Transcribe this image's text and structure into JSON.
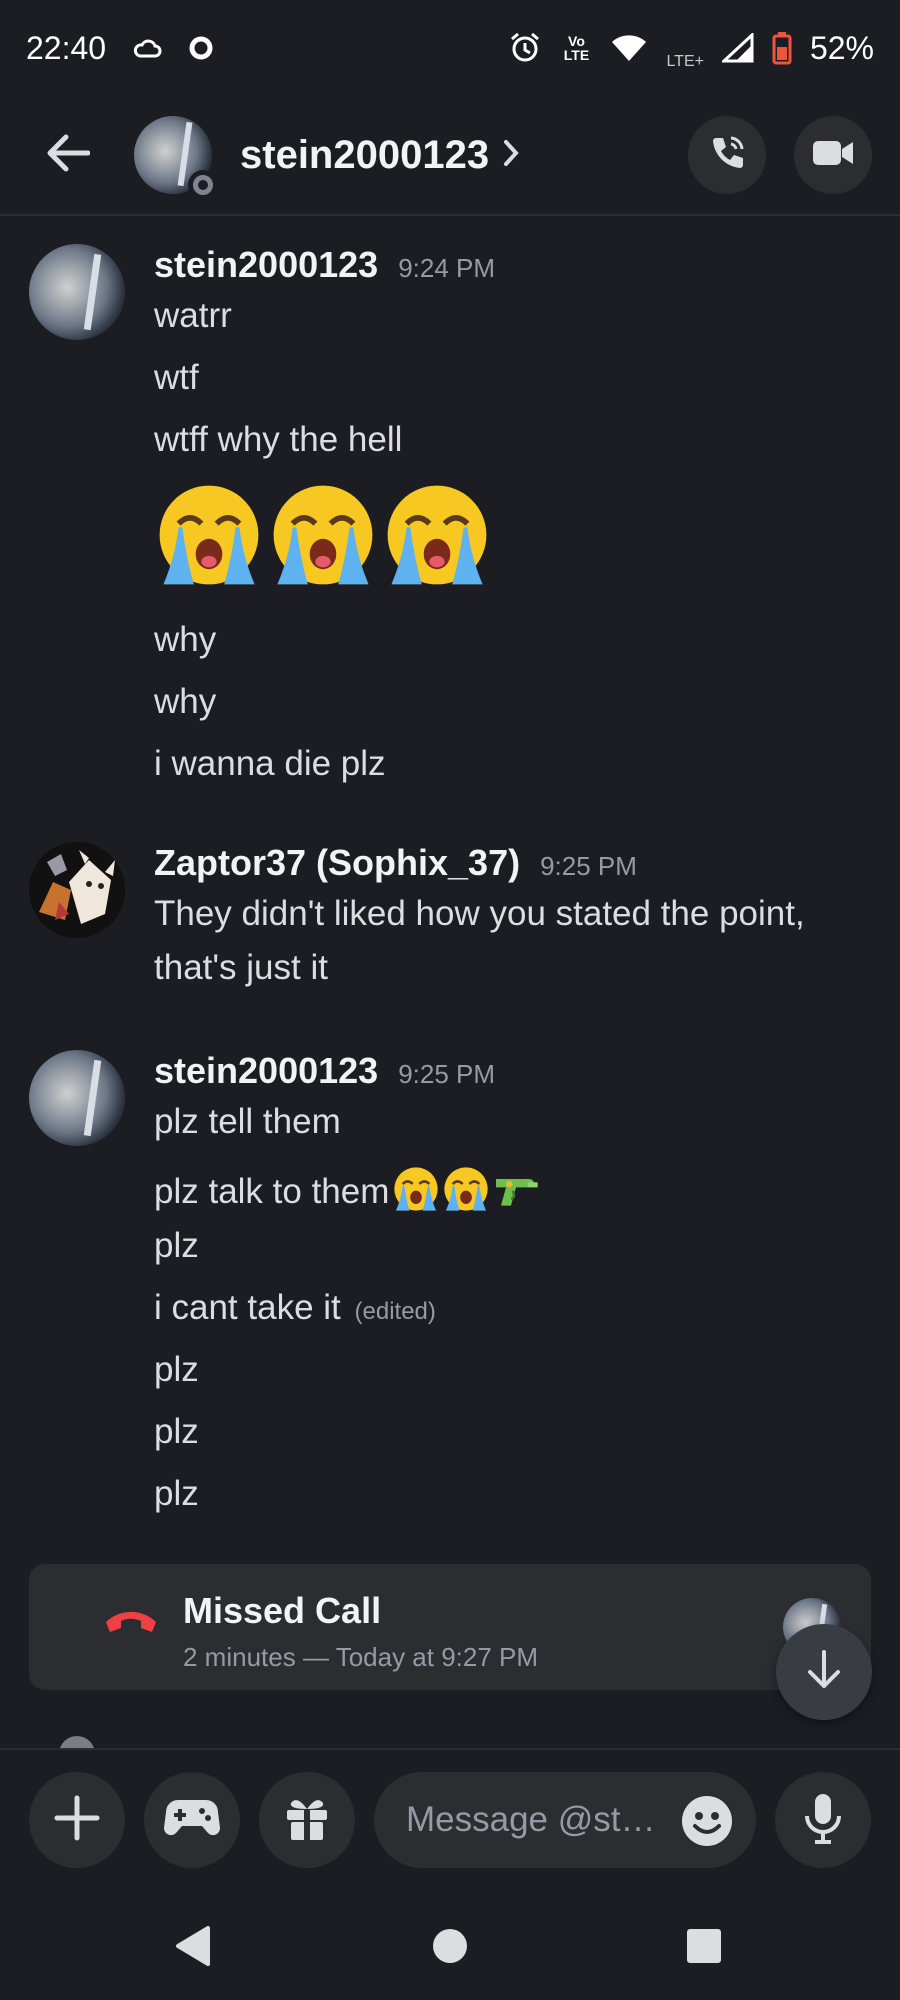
{
  "status_bar": {
    "time": "22:40",
    "battery": "52%",
    "network_label": "LTE+",
    "volte_label": "Vo LTE",
    "icons": [
      "cloud-icon",
      "circle-icon",
      "alarm-icon",
      "volte-icon",
      "wifi-icon",
      "signal-icon",
      "battery-icon"
    ]
  },
  "header": {
    "username": "stein2000123",
    "icons": [
      "back-arrow-icon",
      "chevron-right-icon",
      "voice-call-icon",
      "video-call-icon"
    ]
  },
  "messages": [
    {
      "author": "stein2000123",
      "time": "9:24 PM",
      "lines": [
        "watrr",
        "wtf",
        "wtff why the hell",
        "why",
        "why",
        "i wanna die plz"
      ],
      "emoji": [
        "loudly-crying-emoji",
        "loudly-crying-emoji",
        "loudly-crying-emoji"
      ]
    },
    {
      "author": "Zaptor37 (Sophix_37)",
      "time": "9:25 PM",
      "lines": [
        "They didn't liked how you stated the point,",
        "that's just it"
      ]
    },
    {
      "author": "stein2000123",
      "time": "9:25 PM",
      "lines": [
        "plz tell them",
        "plz talk to them",
        "plz",
        "i cant take it",
        "plz",
        "plz",
        "plz"
      ],
      "edited_label": "(edited)",
      "inline_emoji": [
        "loudly-crying-emoji",
        "loudly-crying-emoji",
        "water-pistol-emoji"
      ]
    }
  ],
  "missed_call": {
    "title": "Missed Call",
    "subtitle": "2 minutes — Today at 9:27 PM"
  },
  "input_bar": {
    "placeholder": "Message @st…",
    "buttons": [
      "plus-icon",
      "gamepad-icon",
      "gift-icon",
      "emoji-icon",
      "microphone-icon"
    ]
  },
  "nav_bar": {
    "buttons": [
      "back-triangle-icon",
      "home-circle-icon",
      "recents-square-icon"
    ]
  },
  "colors": {
    "background": "#1c1d22",
    "surface": "#2b2d31",
    "text": "#dbdee1",
    "muted": "#949ba4",
    "missed_call_red": "#f23f43"
  }
}
